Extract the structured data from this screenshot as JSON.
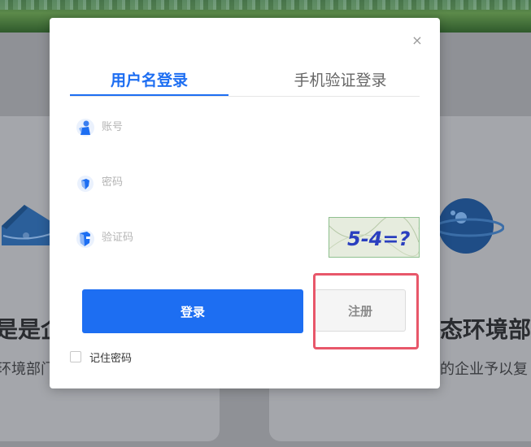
{
  "background": {
    "left_title": "是是企业",
    "left_sub": "环境部门",
    "right_title": "态环境部",
    "right_sub": "的企业予以复"
  },
  "login_modal": {
    "close_label": "×",
    "tabs": [
      {
        "label": "用户名登录",
        "active": true
      },
      {
        "label": "手机验证登录",
        "active": false
      }
    ],
    "fields": {
      "account_placeholder": "账号",
      "password_placeholder": "密码",
      "captcha_placeholder": "验证码"
    },
    "captcha_text": "5-4=?",
    "login_button": "登录",
    "register_button": "注册",
    "remember_label": "记住密码"
  },
  "colors": {
    "accent": "#1d6ef2",
    "highlight": "#e8576a"
  }
}
